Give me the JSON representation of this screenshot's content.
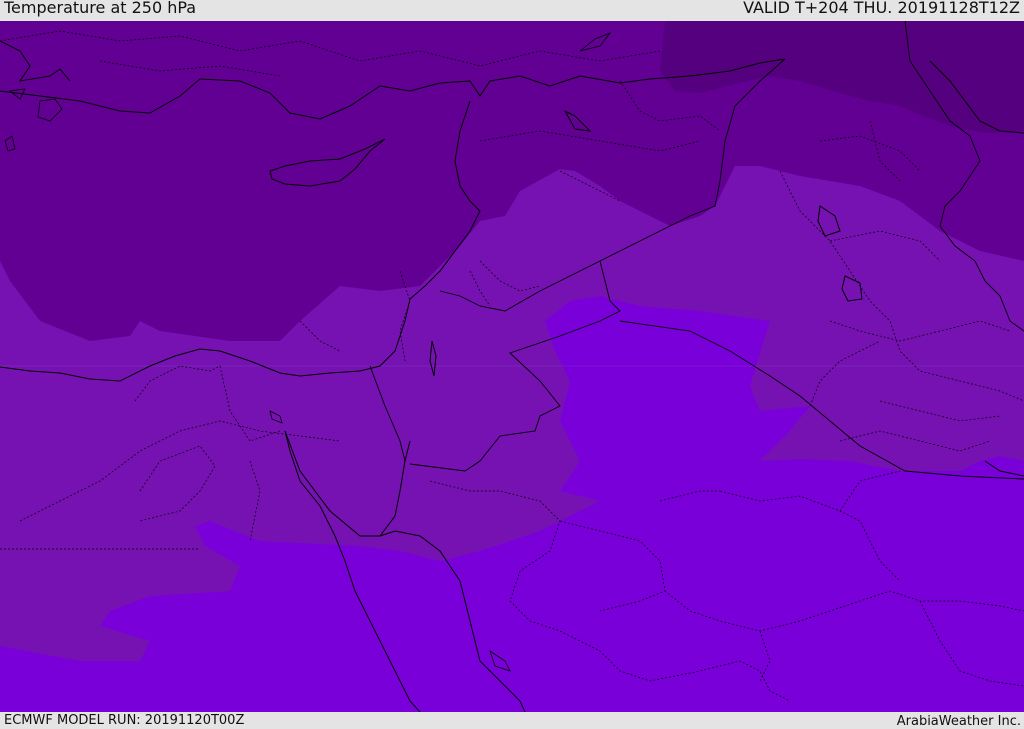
{
  "header": {
    "title": "Temperature at 250 hPa",
    "valid": "VALID T+204 THU. 20191128T12Z"
  },
  "footer": {
    "model_run": "ECMWF MODEL RUN: 20191120T00Z",
    "credit": "ArabiaWeather Inc."
  },
  "map": {
    "variable": "temperature",
    "level": "250 hPa",
    "region": "Eastern Mediterranean and Middle East",
    "colors": {
      "darkest": "#54007f",
      "dark": "#620094",
      "mid": "#7612b2",
      "light": "#7a00d9",
      "border": "#000000"
    }
  }
}
